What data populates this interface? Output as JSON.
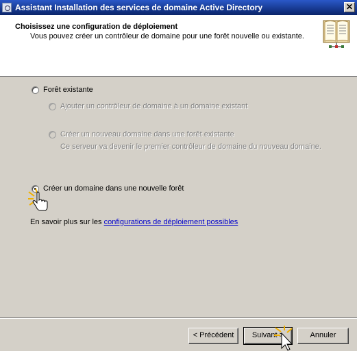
{
  "window": {
    "title": "Assistant Installation des services de domaine Active Directory",
    "close_glyph": "✕"
  },
  "header": {
    "title": "Choisissez une configuration de déploiement",
    "subtitle": "Vous pouvez créer un contrôleur de domaine pour une forêt nouvelle ou existante.",
    "icon": "book-icon"
  },
  "options": {
    "existing_forest": "Forêt existante",
    "add_dc": "Ajouter un contrôleur de domaine à un domaine existant",
    "new_domain_existing_forest": "Créer un nouveau domaine dans une forêt existante",
    "new_domain_existing_forest_desc": "Ce serveur va devenir le premier contrôleur de domaine du nouveau domaine.",
    "new_forest": "Créer un domaine dans une nouvelle forêt",
    "selected": "new_forest"
  },
  "help": {
    "prefix": "En savoir plus sur les ",
    "link": "configurations de déploiement possibles"
  },
  "buttons": {
    "back": "< Précédent",
    "next": "Suivant >",
    "cancel": "Annuler"
  }
}
